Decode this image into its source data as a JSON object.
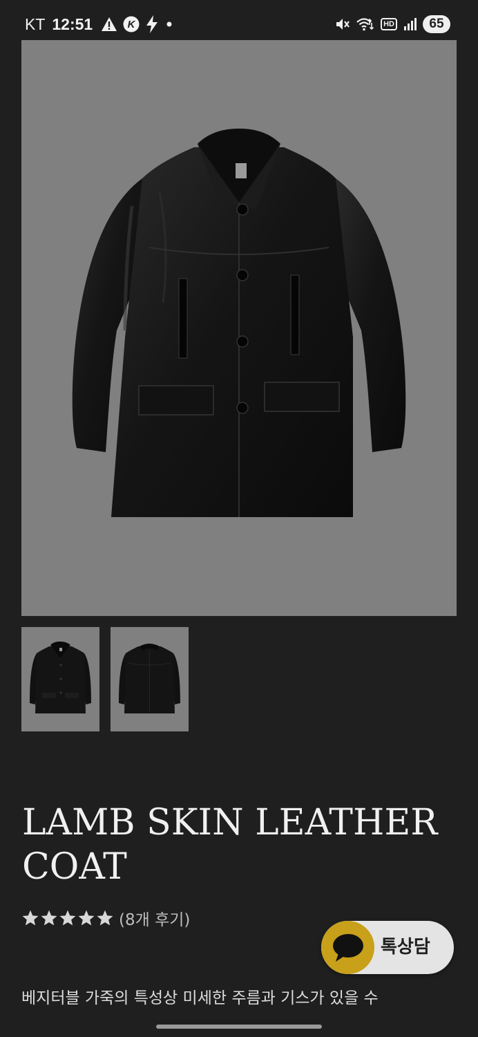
{
  "status_bar": {
    "carrier": "KT",
    "time": "12:51",
    "left_icons": [
      "warning-icon",
      "kakao-k-icon",
      "bolt-icon",
      "dot-icon"
    ],
    "right_icons": [
      "vibrate-mute-icon",
      "wifi-icon",
      "hd-voice-icon",
      "signal-icon"
    ],
    "hd_label": "HD",
    "battery": "65"
  },
  "product": {
    "main_image_icon": "leather-coat-front-photo",
    "thumbnails": [
      {
        "icon": "leather-coat-front-thumbnail"
      },
      {
        "icon": "leather-coat-back-thumbnail"
      }
    ],
    "title": "LAMB SKIN LEATHER COAT",
    "rating": {
      "stars": 5,
      "max_stars": 5,
      "review_count_text": "(8개 후기)"
    },
    "description": "베지터블 가죽의 특성상 미세한 주름과 기스가 있을 수"
  },
  "chat_button": {
    "label": "톡상담",
    "icon": "speech-bubble-icon"
  },
  "colors": {
    "background": "#1f1f1f",
    "image_background": "#808080",
    "chat_button_bg": "#e4e4e4",
    "chat_icon_bg": "#c8a01a",
    "text_primary": "#f0f0f0",
    "text_secondary": "#bdbdbd"
  }
}
